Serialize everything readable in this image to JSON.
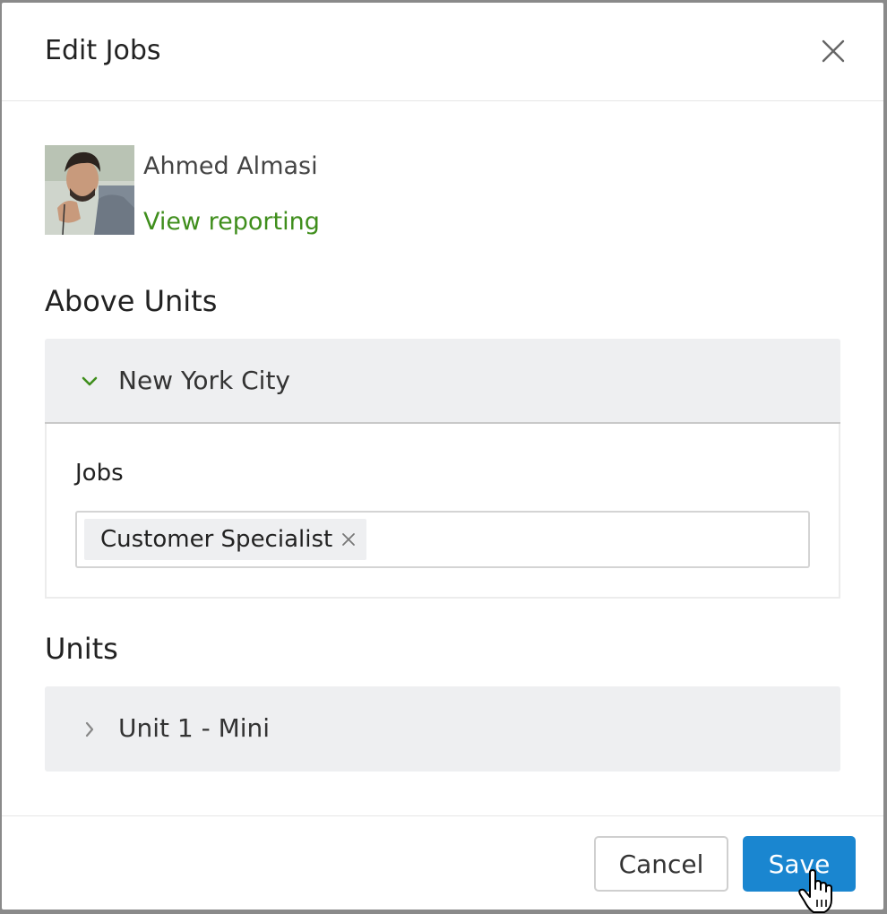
{
  "dialog": {
    "title": "Edit Jobs",
    "close_icon": "close-icon"
  },
  "user": {
    "name": "Ahmed Almasi",
    "view_reporting_label": "View reporting"
  },
  "above_units": {
    "section_title": "Above Units",
    "group": {
      "label": "New York City",
      "expanded": true,
      "icon": "chevron-down-icon",
      "jobs_label": "Jobs",
      "jobs": [
        {
          "label": "Customer Specialist"
        }
      ]
    }
  },
  "units": {
    "section_title": "Units",
    "items": [
      {
        "label": "Unit 1 - Mini",
        "expanded": false,
        "icon": "chevron-right-icon"
      }
    ]
  },
  "footer": {
    "cancel_label": "Cancel",
    "save_label": "Save"
  },
  "colors": {
    "accent_green": "#3f8e1c",
    "primary_blue": "#1a86d0",
    "panel_gray": "#eeeff1"
  }
}
